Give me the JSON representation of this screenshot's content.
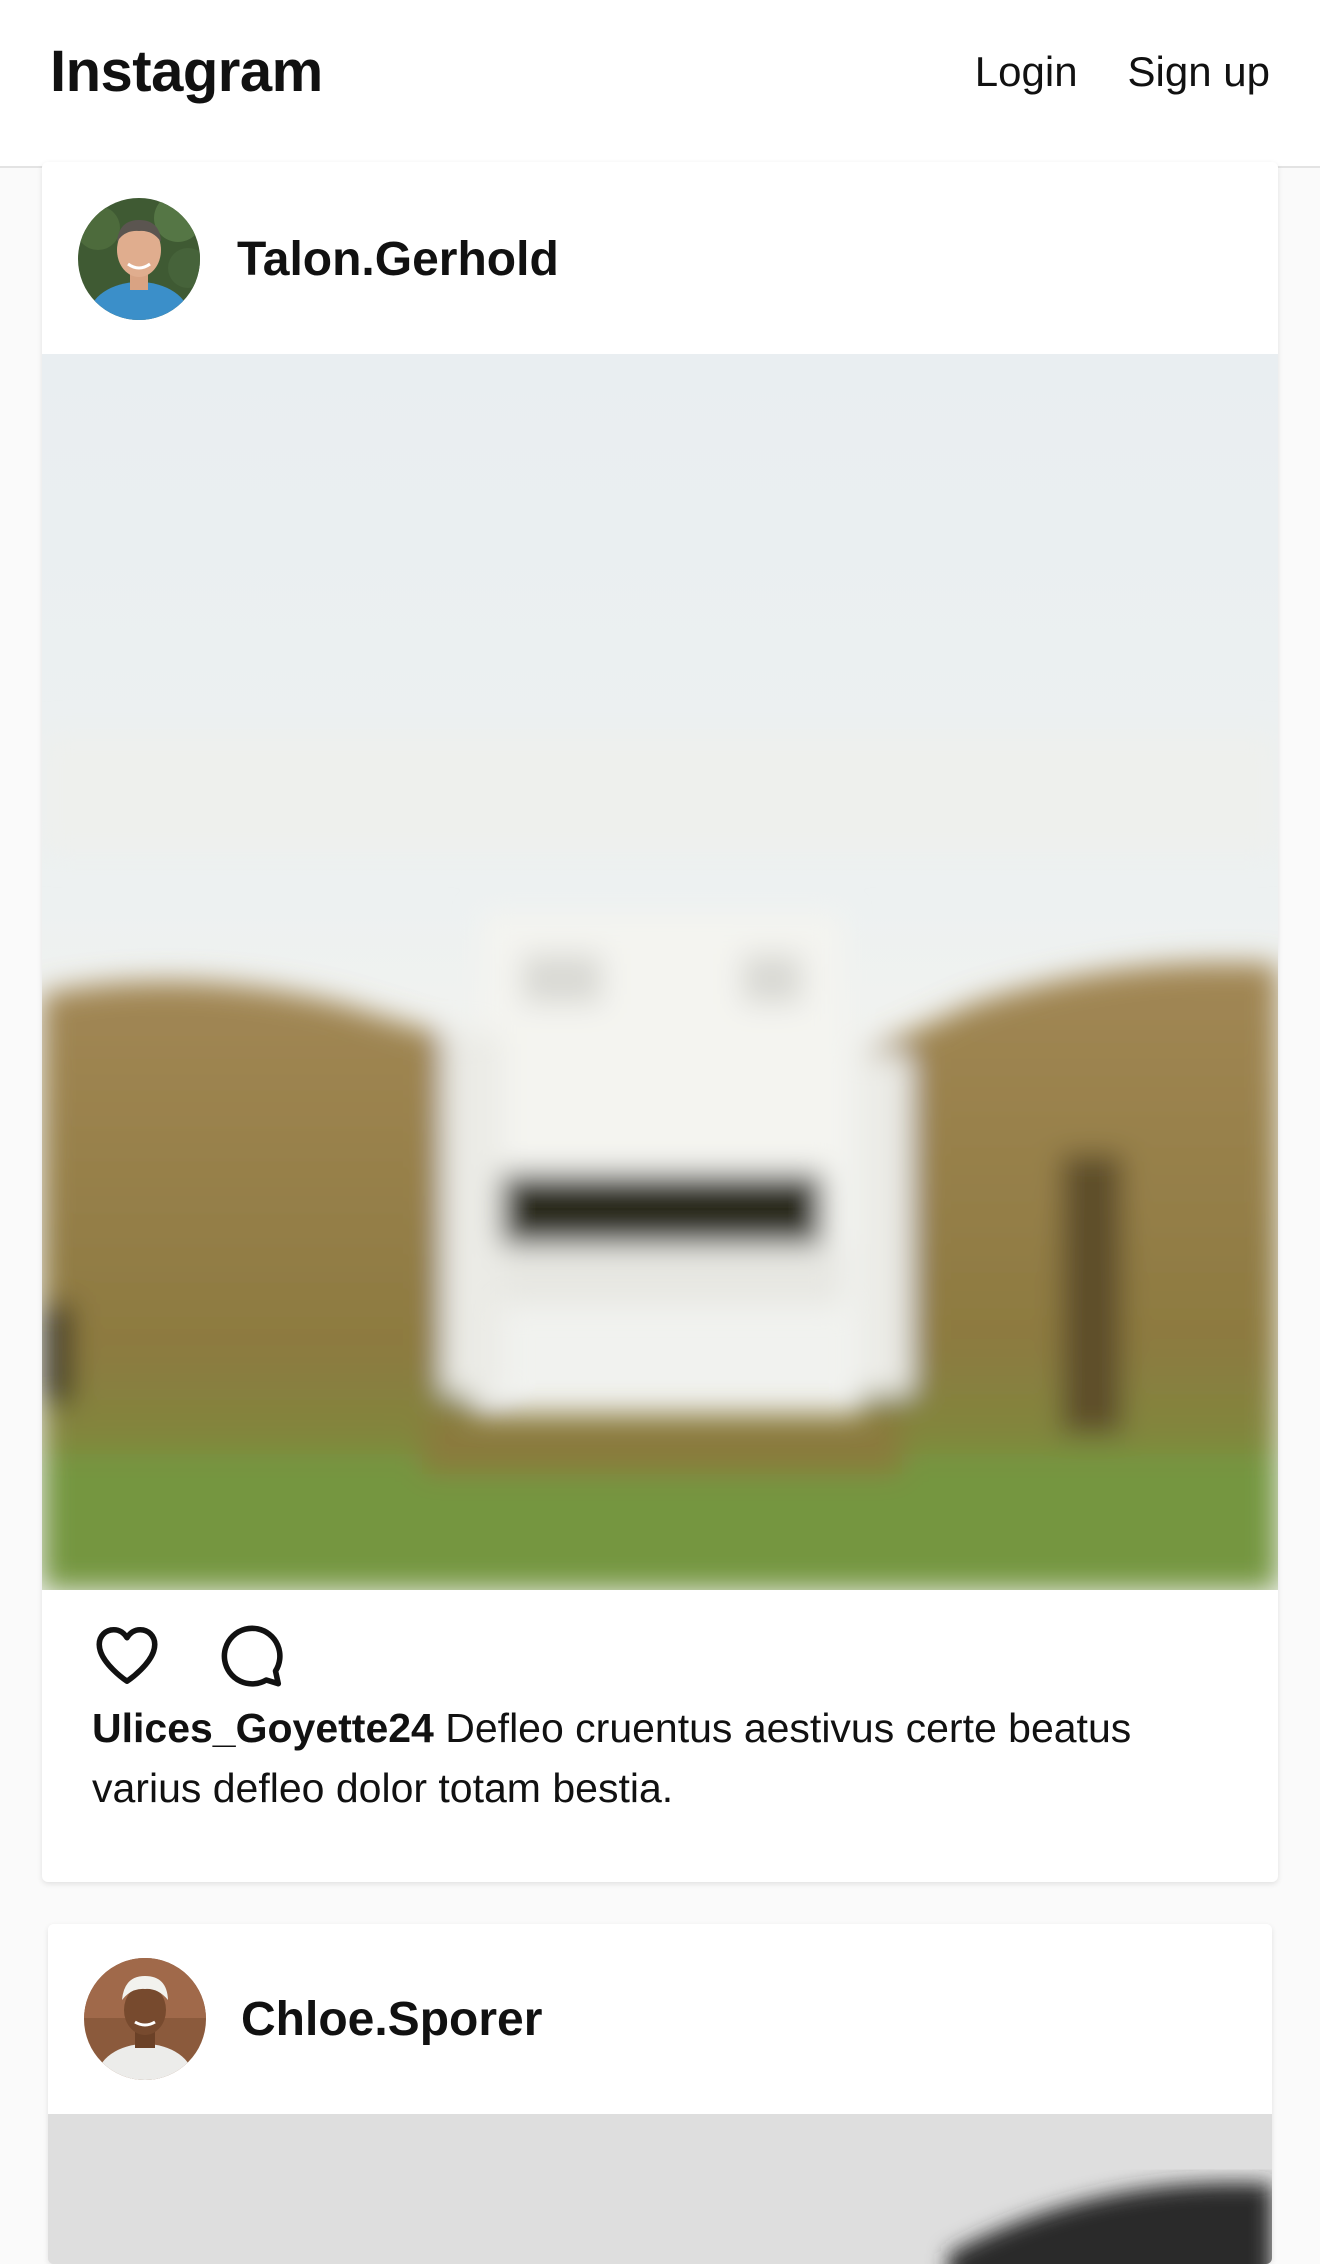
{
  "header": {
    "brand": "Instagram",
    "login_label": "Login",
    "signup_label": "Sign up"
  },
  "posts": [
    {
      "username": "Talon.Gerhold",
      "caption_user": "Ulices_Goyette24",
      "caption_text": "Defleo cruentus aestivus certe beatus varius defleo dolor totam bestia.",
      "actions": {
        "like_icon": "heart-icon",
        "comment_icon": "comment-bubble-icon"
      }
    },
    {
      "username": "Chloe.Sporer"
    }
  ],
  "colors": {
    "background": "#fafafa",
    "card": "#ffffff",
    "text": "#111111"
  }
}
